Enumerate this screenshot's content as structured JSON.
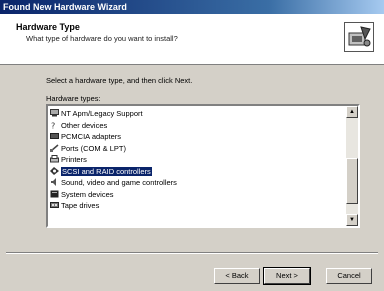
{
  "window": {
    "title": "Found New Hardware Wizard"
  },
  "header": {
    "title": "Hardware Type",
    "subtitle": "What type of hardware do you want to install?",
    "icon": "hardware-wizard-icon"
  },
  "instruction": "Select a hardware type, and then click Next.",
  "list": {
    "label": "Hardware types:",
    "items": [
      {
        "label": "NT Apm/Legacy Support",
        "icon": "computer-icon"
      },
      {
        "label": "Other devices",
        "icon": "question-icon"
      },
      {
        "label": "PCMCIA adapters",
        "icon": "card-icon"
      },
      {
        "label": "Ports (COM & LPT)",
        "icon": "port-icon"
      },
      {
        "label": "Printers",
        "icon": "printer-icon"
      },
      {
        "label": "SCSI and RAID controllers",
        "icon": "scsi-icon",
        "selected": true
      },
      {
        "label": "Sound, video and game controllers",
        "icon": "sound-icon"
      },
      {
        "label": "System devices",
        "icon": "system-icon"
      },
      {
        "label": "Tape drives",
        "icon": "tape-icon"
      }
    ]
  },
  "buttons": {
    "back": "< Back",
    "next": "Next >",
    "cancel": "Cancel"
  },
  "colors": {
    "selection": "#0a246a",
    "title_bar": "#0a246a",
    "face": "#d4d0c8"
  }
}
